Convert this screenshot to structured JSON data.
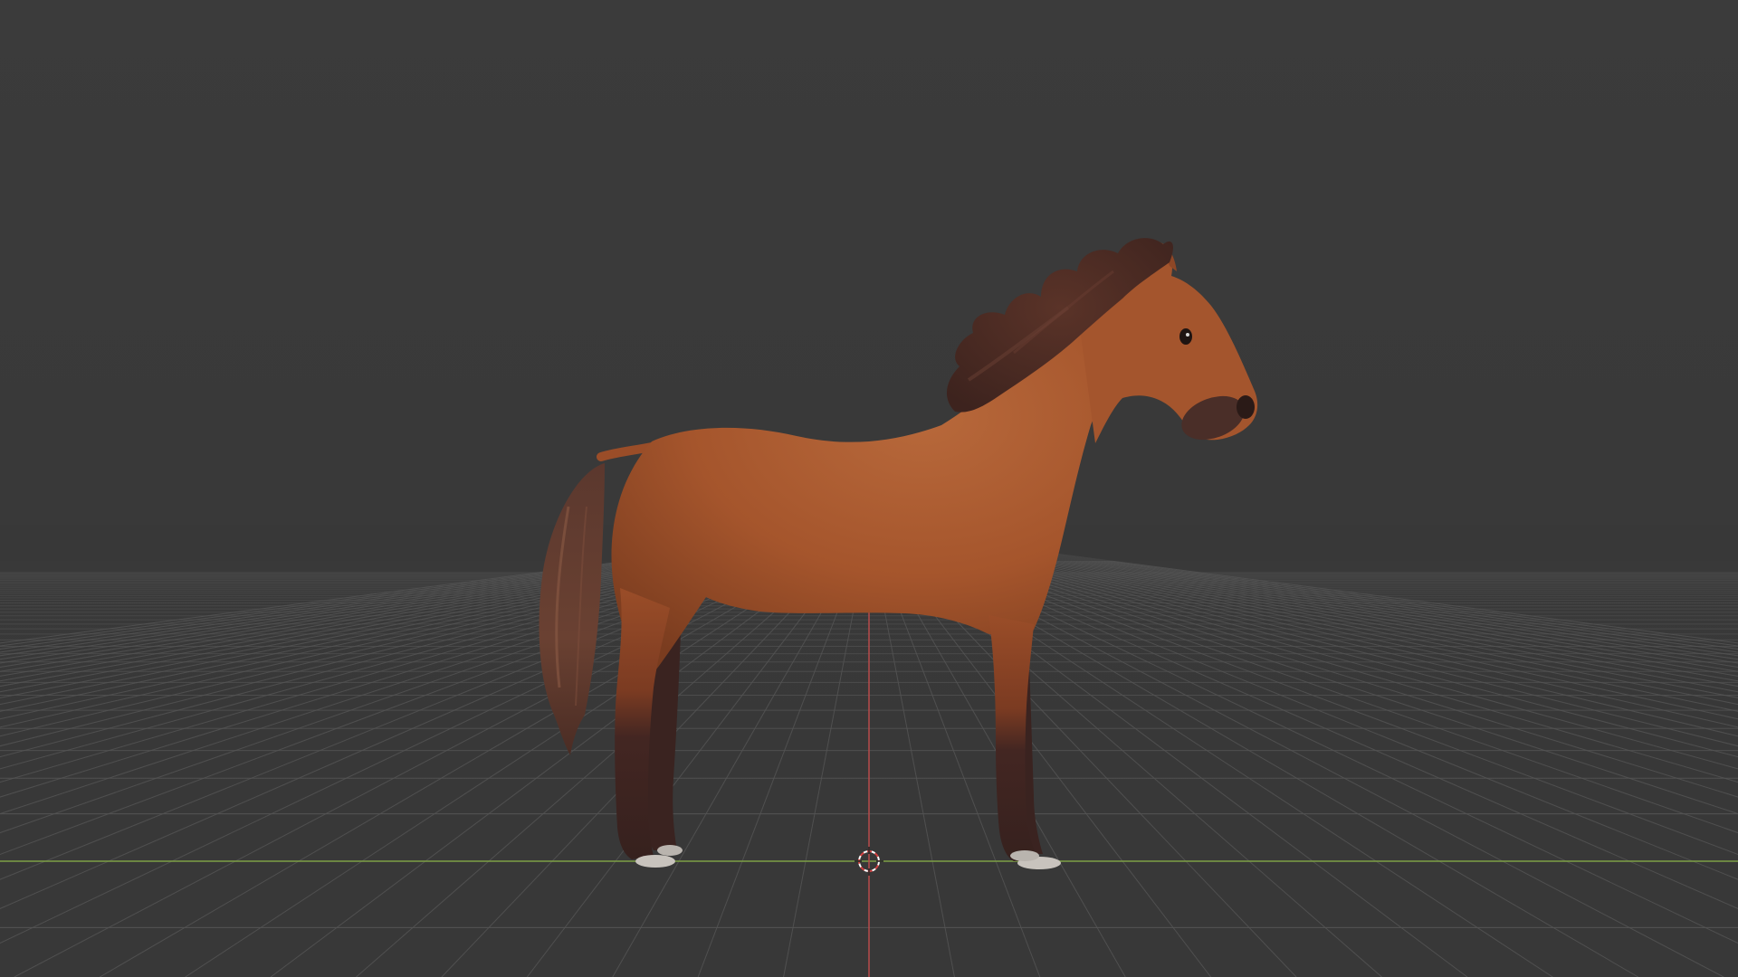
{
  "viewport": {
    "background_color": "#393939",
    "grid_line_color": "#545454",
    "x_axis_color": "#7da045",
    "y_axis_color": "#b84a4a",
    "grid_visible": true
  },
  "scene": {
    "object": "horse",
    "body_color": "#a85830",
    "body_shadow_color": "#6e3a20",
    "mane_color": "#4a2a22",
    "lower_leg_color": "#3c2420",
    "hoof_color": "#c8c3bd"
  },
  "icons": {
    "cursor": "3d-cursor-icon"
  }
}
